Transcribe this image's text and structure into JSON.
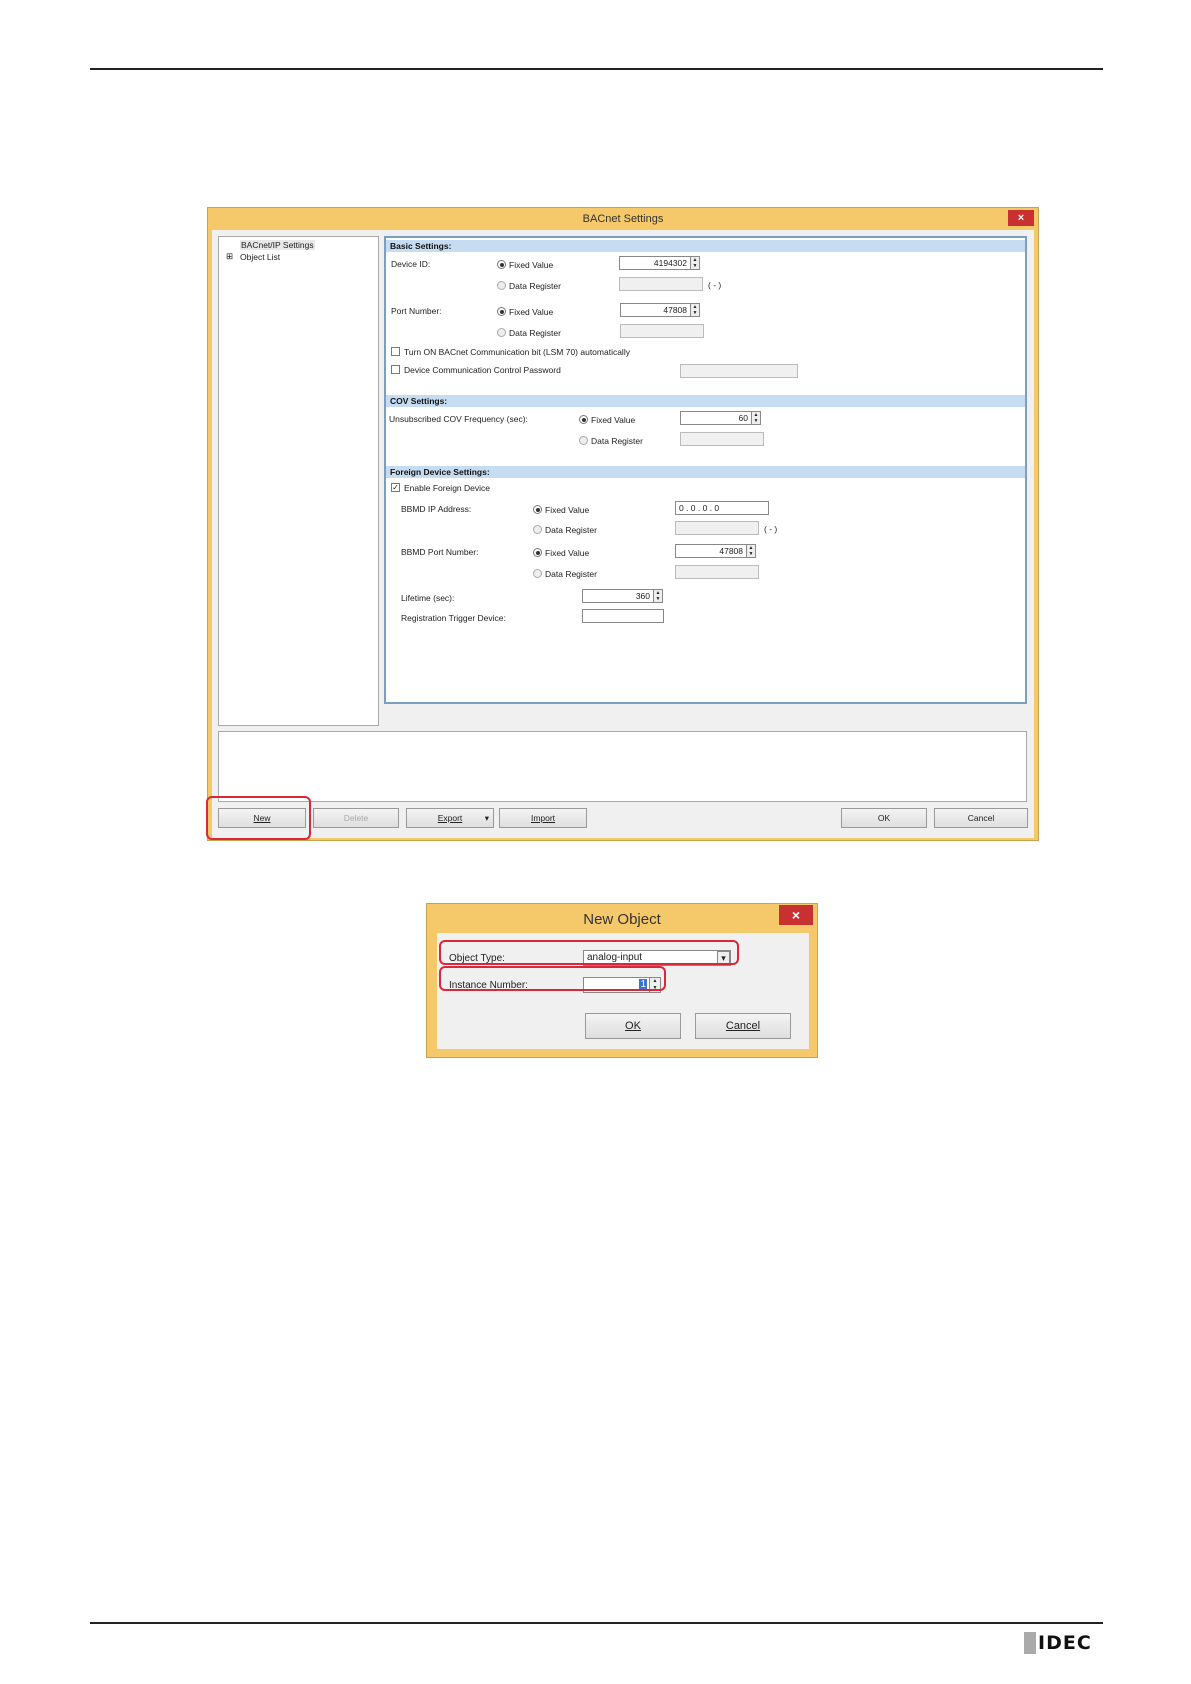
{
  "bacnet_dialog": {
    "title": "BACnet Settings",
    "close_glyph": "×",
    "tree": {
      "item_settings": "BACnet/IP Settings",
      "expander": "⊞",
      "item_objects": "Object List"
    },
    "basic": {
      "header": "Basic Settings:",
      "device_id_label": "Device ID:",
      "fixed_value": "Fixed Value",
      "data_register": "Data Register",
      "device_id_value": "4194302",
      "register_suffix": "( - )",
      "port_label": "Port Number:",
      "port_value": "47808",
      "turn_on_label": "Turn ON BACnet Communication bit (LSM 70) automatically",
      "password_label": "Device Communication Control Password"
    },
    "cov": {
      "header": "COV Settings:",
      "freq_label": "Unsubscribed COV Frequency (sec):",
      "fixed_value": "Fixed Value",
      "data_register": "Data Register",
      "freq_value": "60"
    },
    "foreign": {
      "header": "Foreign Device Settings:",
      "enable_label": "Enable Foreign Device",
      "bbmd_ip_label": "BBMD IP Address:",
      "fixed_value": "Fixed Value",
      "data_register": "Data Register",
      "ip_value": "0  .  0  .  0  .  0",
      "register_suffix": "( - )",
      "bbmd_port_label": "BBMD Port Number:",
      "bbmd_port_value": "47808",
      "lifetime_label": "Lifetime (sec):",
      "lifetime_value": "360",
      "trigger_label": "Registration Trigger Device:"
    },
    "buttons": {
      "new": "New",
      "delete": "Delete",
      "export": "Export",
      "export_arrow": "▾",
      "import": "Import",
      "ok": "OK",
      "cancel": "Cancel"
    }
  },
  "new_object_dialog": {
    "title": "New Object",
    "close_glyph": "×",
    "object_type_label": "Object Type:",
    "object_type_value": "analog-input",
    "dropdown_glyph": "▾",
    "instance_label": "Instance Number:",
    "instance_value": "1",
    "ok": "OK",
    "cancel": "Cancel"
  },
  "footer": {
    "logo": "IDEC"
  }
}
